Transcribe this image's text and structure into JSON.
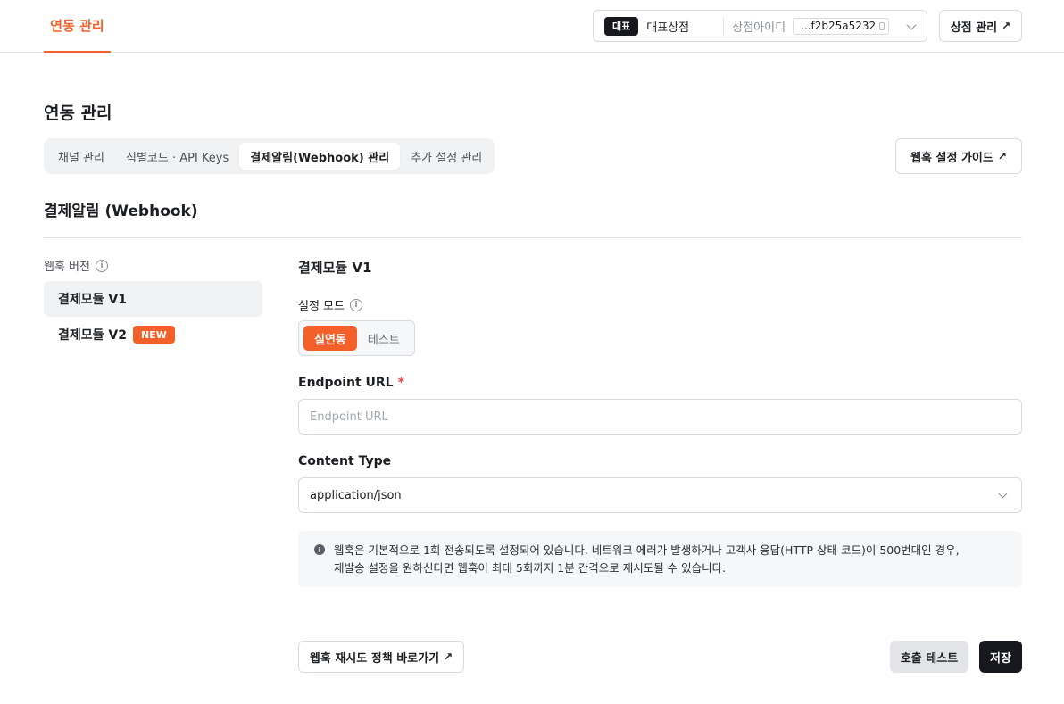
{
  "topbar": {
    "tab_label": "연동 관리",
    "store_badge": "대표",
    "store_name": "대표상점",
    "store_id_label": "상점아이디",
    "store_id_value": "...f2b25a5232",
    "manage_store_label": "상점 관리"
  },
  "page": {
    "title": "연동 관리",
    "subtabs": [
      {
        "label": "채널 관리"
      },
      {
        "label": "식별코드 · API Keys"
      },
      {
        "label": "결제알림(Webhook) 관리"
      },
      {
        "label": "추가 설정 관리"
      }
    ],
    "guide_button": "웹훅 설정 가이드",
    "section_title": "결제알림 (Webhook)"
  },
  "sidebar": {
    "heading": "웹훅 버전",
    "items": [
      {
        "label": "결제모듈 V1"
      },
      {
        "label": "결제모듈 V2",
        "badge": "NEW"
      }
    ]
  },
  "form": {
    "title": "결제모듈 V1",
    "mode_label": "설정 모드",
    "mode_options": [
      "실연동",
      "테스트"
    ],
    "endpoint_label": "Endpoint URL",
    "endpoint_required": "*",
    "endpoint_placeholder": "Endpoint URL",
    "content_type_label": "Content Type",
    "content_type_value": "application/json",
    "notice_line1": "웹훅은 기본적으로 1회 전송되도록 설정되어 있습니다. 네트워크 에러가 발생하거나 고객사 응답(HTTP 상태 코드)이 500번대인 경우,",
    "notice_line2": "재발송 설정을 원하신다면 웹훅이 최대 5회까지 1분 간격으로 재시도될 수 있습니다."
  },
  "footer": {
    "retry_policy_link": "웹훅 재시도 정책 바로가기",
    "test_button": "호출 테스트",
    "save_button": "저장"
  },
  "colors": {
    "accent": "#f4602a",
    "dark": "#16181d"
  }
}
